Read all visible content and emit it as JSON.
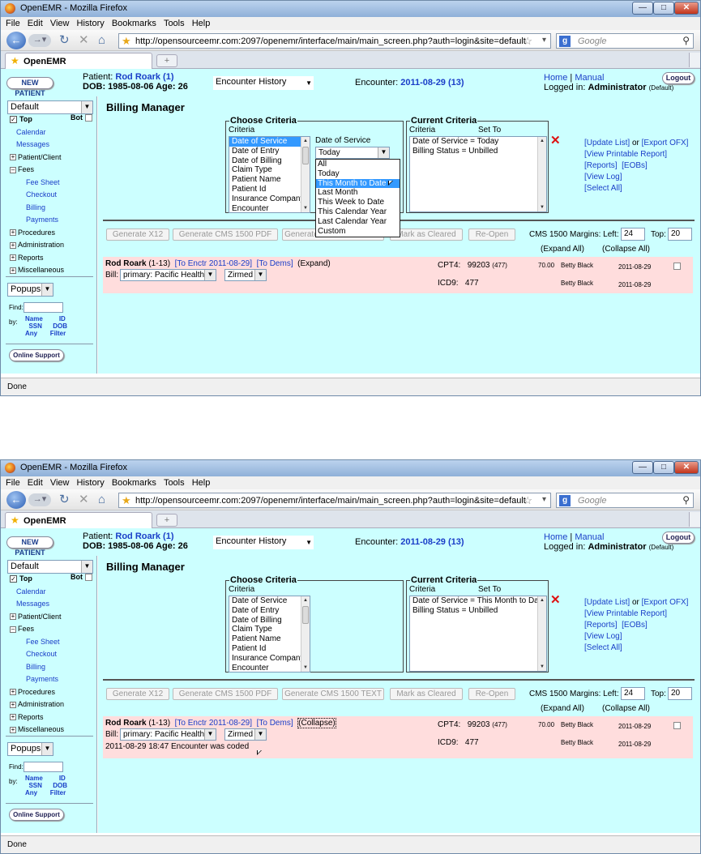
{
  "browser": {
    "title": "OpenEMR - Mozilla Firefox",
    "menu": [
      "File",
      "Edit",
      "View",
      "History",
      "Bookmarks",
      "Tools",
      "Help"
    ],
    "url": "http://opensourceemr.com:2097/openemr/interface/main/main_screen.php?auth=login&site=default",
    "search_placeholder": "Google",
    "tab_label": "OpenEMR",
    "new_tab": "+",
    "status": "Done"
  },
  "header": {
    "new_patient": "NEW PATIENT",
    "patient_label": "Patient:",
    "patient_name": "Rod Roark (1)",
    "dob_line": "DOB: 1985-08-06 Age: 26",
    "encounter_history": "Encounter History",
    "encounter_label": "Encounter:",
    "encounter_value": "2011-08-29 (13)",
    "home": "Home",
    "manual": "Manual",
    "sep": "|",
    "logged_in": "Logged in:",
    "user": "Administrator",
    "default_tag": "(Default)",
    "logout": "Logout"
  },
  "leftnav": {
    "default_select": "Default",
    "top": "Top",
    "bot": "Bot",
    "items": [
      "Calendar",
      "Messages",
      "Patient/Client",
      "Fees",
      "Fee Sheet",
      "Checkout",
      "Billing",
      "Payments",
      "Procedures",
      "Administration",
      "Reports",
      "Miscellaneous"
    ],
    "popups": "Popups",
    "find": "Find:",
    "by": "by:",
    "find_links": [
      "Name",
      "ID",
      "SSN",
      "DOB",
      "Any",
      "Filter"
    ],
    "online_support": "Online Support"
  },
  "billing": {
    "title": "Billing Manager",
    "choose_criteria": "Choose Criteria",
    "criteria": "Criteria",
    "criteria_options": [
      "Date of Service",
      "Date of Entry",
      "Date of Billing",
      "Claim Type",
      "Patient Name",
      "Patient Id",
      "Insurance Company",
      "Encounter"
    ],
    "dos_label": "Date of Service",
    "dos_selected": "Today",
    "dos_options": [
      "All",
      "Today",
      "This Month to Date",
      "Last Month",
      "This Week to Date",
      "This Calendar Year",
      "Last Calendar Year",
      "Custom"
    ],
    "current_criteria": "Current Criteria",
    "set_to": "Set To",
    "current_1": [
      "Date of Service = Today",
      "Billing Status = Unbilled"
    ],
    "current_2": [
      "Date of Service = This Month to Date",
      "Billing Status = Unbilled"
    ],
    "links": {
      "update_list": "[Update List]",
      "or": "or",
      "export_ofx": "[Export OFX]",
      "printable": "[View Printable Report]",
      "reports": "[Reports]",
      "eobs": "[EOBs]",
      "view_log": "[View Log]",
      "select_all": "[Select All]"
    },
    "buttons": [
      "Generate X12",
      "Generate CMS 1500 PDF",
      "Generate CMS 1500 TEXT",
      "Mark as Cleared",
      "Re-Open"
    ],
    "margins_label": "CMS 1500 Margins:",
    "left_label": "Left:",
    "left_value": "24",
    "top_label": "Top:",
    "top_value": "20",
    "expand_all": "(Expand All)",
    "collapse_all": "(Collapse All)",
    "row": {
      "name": "Rod Roark",
      "id": "(1-13)",
      "to_enctr": "[To Enctr 2011-08-29]",
      "to_dems": "[To Dems]",
      "expand": "(Expand)",
      "collapse": "(Collapse)",
      "bill_label": "Bill:",
      "bill_value": "primary: Pacific Health",
      "clearing": "Zirmed",
      "cpt_label": "CPT4:",
      "cpt_code": "99203",
      "cpt_dx": "(477)",
      "icd_label": "ICD9:",
      "icd_code": "477",
      "fee": "70.00",
      "provider": "Betty Black",
      "date": "2011-08-29",
      "coded_note": "2011-08-29 18:47 Encounter was coded"
    }
  }
}
